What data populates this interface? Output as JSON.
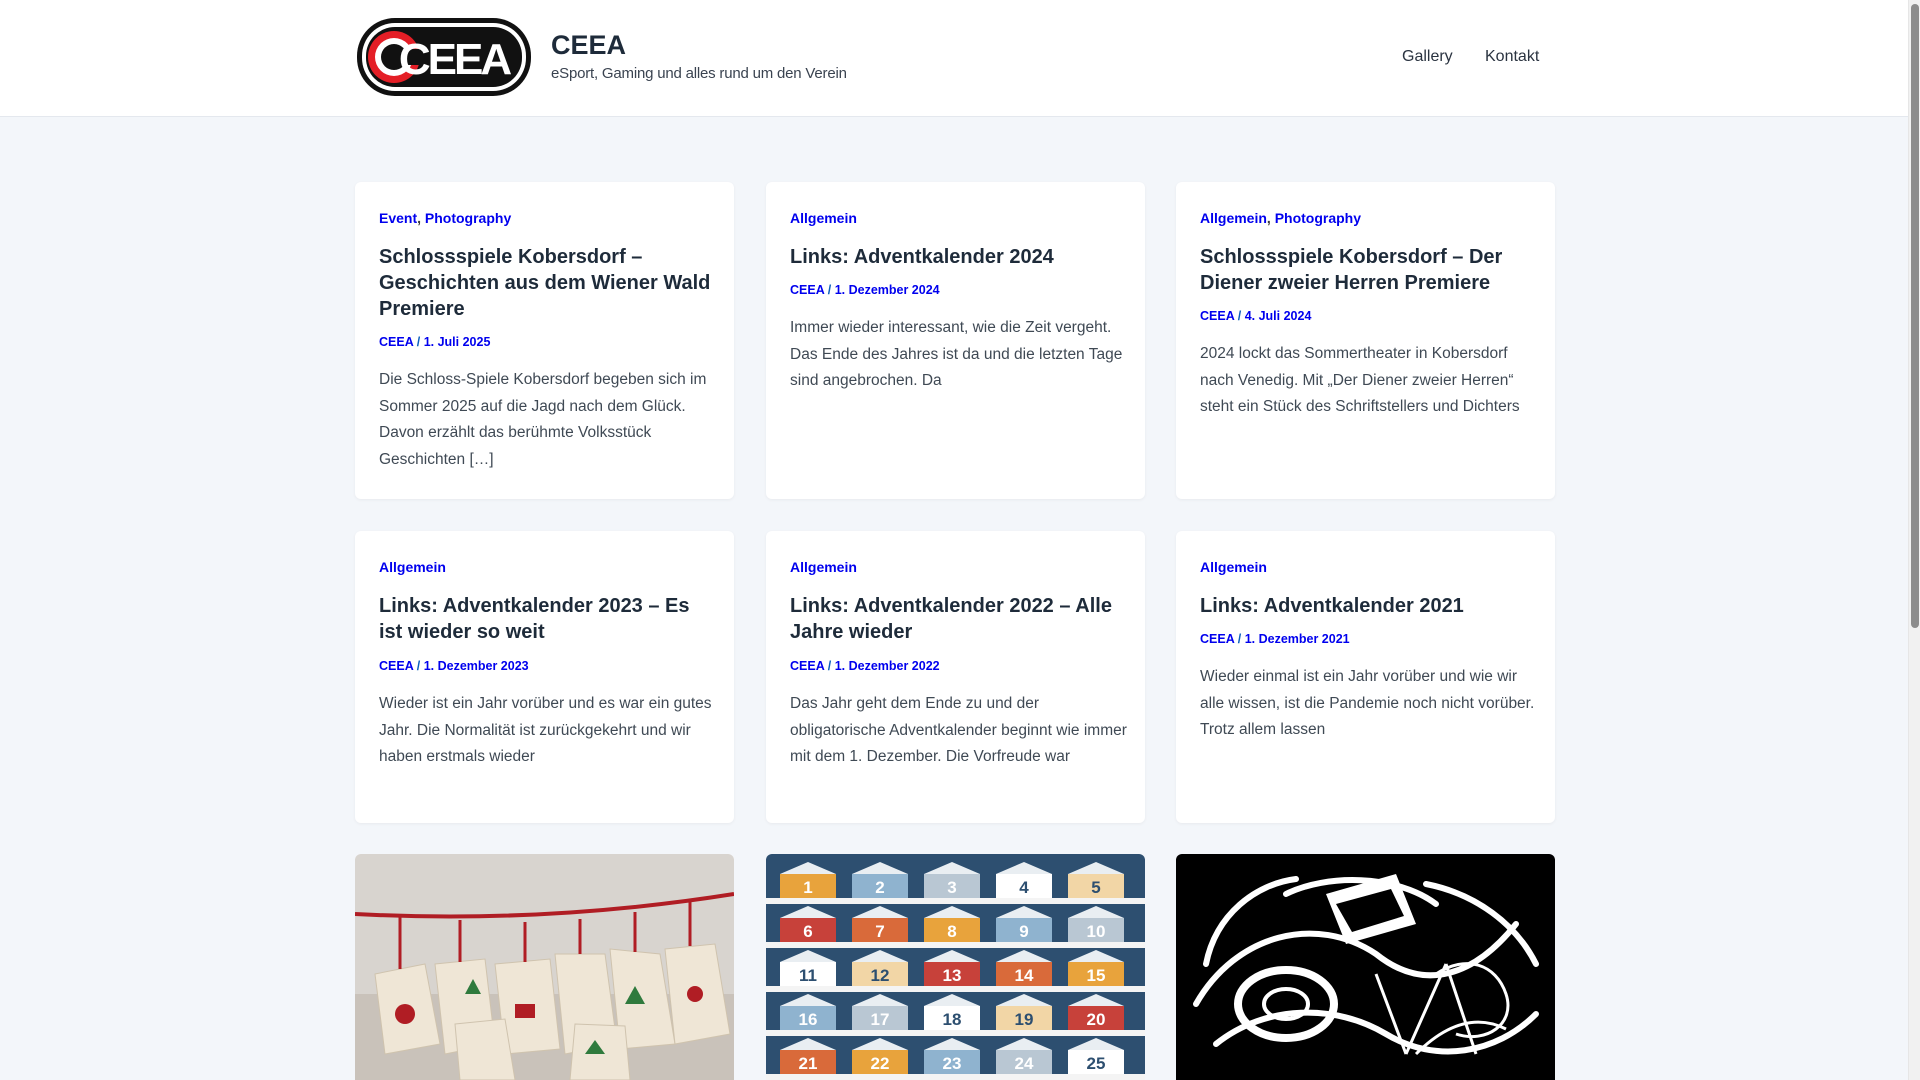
{
  "site": {
    "title": "CEEA",
    "tagline": "eSport, Gaming und alles rund um den Verein",
    "logo_text": "CEEA"
  },
  "nav": {
    "items": [
      {
        "label": "Gallery"
      },
      {
        "label": "Kontakt"
      }
    ]
  },
  "posts": [
    {
      "categories": [
        "Event",
        "Photography"
      ],
      "title": "Schlossspiele Kobersdorf – Geschichten aus dem Wiener Wald Premiere",
      "author": "CEEA",
      "date": "1. Juli 2025",
      "excerpt": "Die Schloss-Spiele Kobersdorf begeben sich im Sommer 2025 auf die Jagd nach dem Glück. Davon erzählt das berühmte Volksstück Geschichten […]"
    },
    {
      "categories": [
        "Allgemein"
      ],
      "title": "Links: Adventkalender 2024",
      "author": "CEEA",
      "date": "1. Dezember 2024",
      "excerpt": "Immer wieder interessant, wie die Zeit vergeht. Das Ende des Jahres ist da und die letzten Tage sind angebrochen. Da"
    },
    {
      "categories": [
        "Allgemein",
        "Photography"
      ],
      "title": "Schlossspiele Kobersdorf – Der Diener zweier Herren Premiere",
      "author": "CEEA",
      "date": "4. Juli 2024",
      "excerpt": "2024 lockt das Sommertheater in Kobersdorf nach Venedig. Mit „Der Diener zweier Herren“ steht ein Stück des Schriftstellers und Dichters"
    },
    {
      "categories": [
        "Allgemein"
      ],
      "title": "Links: Adventkalender 2023 – Es ist wieder so weit",
      "author": "CEEA",
      "date": "1. Dezember 2023",
      "excerpt": "Wieder ist ein Jahr vorüber und es war ein gutes Jahr. Die Normalität ist zurückgekehrt und wir haben erstmals wieder"
    },
    {
      "categories": [
        "Allgemein"
      ],
      "title": "Links: Adventkalender 2022 – Alle Jahre wieder",
      "author": "CEEA",
      "date": "1. Dezember 2022",
      "excerpt": "Das Jahr geht dem Ende zu und der obligatorische Adventkalender beginnt wie immer mit dem 1. Dezember. Die Vorfreude war"
    },
    {
      "categories": [
        "Allgemein"
      ],
      "title": "Links: Adventkalender 2021",
      "author": "CEEA",
      "date": "1. Dezember 2021",
      "excerpt": "Wieder einmal ist ein Jahr vorüber und wie wir alle wissen, ist die Pandemie noch nicht vorüber. Trotz allem lassen"
    }
  ],
  "calendar_numbers": [
    "1",
    "2",
    "3",
    "4",
    "5",
    "6",
    "7",
    "8",
    "9",
    "10",
    "11",
    "12",
    "13",
    "14",
    "15",
    "16",
    "17",
    "18",
    "19",
    "20",
    "21",
    "22",
    "23",
    "24",
    "25"
  ],
  "colors": {
    "accent": "#0a5fbd",
    "heading": "#1e2b3a",
    "background": "#f3f6fa"
  }
}
